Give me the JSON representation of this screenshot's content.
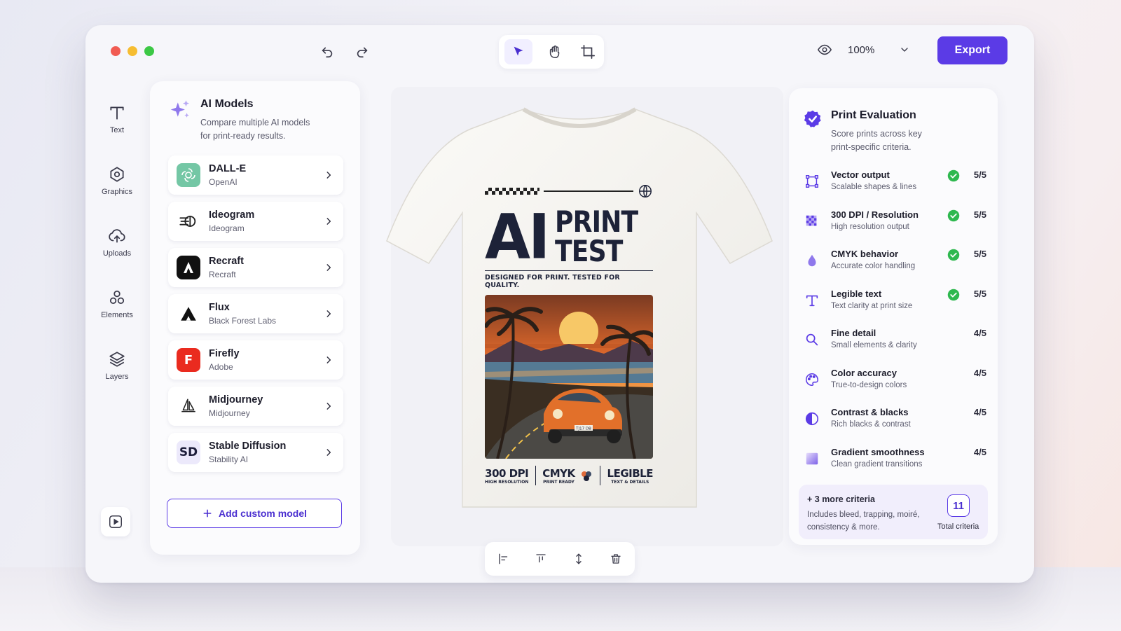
{
  "toolbar": {
    "zoom": "100%",
    "export_label": "Export"
  },
  "rail": [
    {
      "label": "Text",
      "icon": "text-icon"
    },
    {
      "label": "Graphics",
      "icon": "graphics-icon"
    },
    {
      "label": "Uploads",
      "icon": "upload-icon"
    },
    {
      "label": "Elements",
      "icon": "elements-icon"
    },
    {
      "label": "Layers",
      "icon": "layers-icon"
    }
  ],
  "models_panel": {
    "title": "AI Models",
    "subtitle": "Compare multiple AI models for print-ready results.",
    "models": [
      {
        "name": "DALL-E",
        "vendor": "OpenAI",
        "logo": "openai-logo-icon",
        "color": "#74c7a5"
      },
      {
        "name": "Ideogram",
        "vendor": "Ideogram",
        "logo": "ideogram-logo-icon",
        "color": "#ffffff"
      },
      {
        "name": "Recraft",
        "vendor": "Recraft",
        "logo": "recraft-logo-icon",
        "color": "#111111"
      },
      {
        "name": "Flux",
        "vendor": "Black Forest Labs",
        "logo": "flux-logo-icon",
        "color": "#ffffff"
      },
      {
        "name": "Firefly",
        "vendor": "Adobe",
        "logo": "firefly-logo-icon",
        "color": "#ea2b1f",
        "mark": "F"
      },
      {
        "name": "Midjourney",
        "vendor": "Midjourney",
        "logo": "midjourney-logo-icon",
        "color": "#ffffff"
      },
      {
        "name": "Stable Diffusion",
        "vendor": "Stability AI",
        "logo": "stable-diffusion-logo-icon",
        "color": "#ece9fb",
        "mark": "SD"
      }
    ],
    "add_label": "Add custom model"
  },
  "design": {
    "headline_big": "AI",
    "headline_line1": "PRINT",
    "headline_line2": "TEST",
    "tagline": "DESIGNED FOR PRINT. TESTED FOR QUALITY.",
    "plate": "TJ17 DB",
    "stats": [
      {
        "big": "300 DPI",
        "small": "HIGH RESOLUTION"
      },
      {
        "big": "CMYK",
        "small": "PRINT READY"
      },
      {
        "big": "LEGIBLE",
        "small": "TEXT & DETAILS"
      }
    ]
  },
  "evaluation": {
    "title": "Print Evaluation",
    "subtitle": "Score prints across key print-specific criteria.",
    "criteria": [
      {
        "name": "Vector output",
        "desc": "Scalable shapes & lines",
        "score": "5/5",
        "passed": true,
        "icon": "vector-icon"
      },
      {
        "name": "300 DPI / Resolution",
        "desc": "High resolution output",
        "score": "5/5",
        "passed": true,
        "icon": "resolution-icon"
      },
      {
        "name": "CMYK behavior",
        "desc": "Accurate color handling",
        "score": "5/5",
        "passed": true,
        "icon": "droplet-icon"
      },
      {
        "name": "Legible text",
        "desc": "Text clarity at print size",
        "score": "5/5",
        "passed": true,
        "icon": "text-icon"
      },
      {
        "name": "Fine detail",
        "desc": "Small elements & clarity",
        "score": "4/5",
        "passed": false,
        "icon": "magnifier-icon"
      },
      {
        "name": "Color accuracy",
        "desc": "True-to-design colors",
        "score": "4/5",
        "passed": false,
        "icon": "palette-icon"
      },
      {
        "name": "Contrast & blacks",
        "desc": "Rich blacks & contrast",
        "score": "4/5",
        "passed": false,
        "icon": "contrast-icon"
      },
      {
        "name": "Gradient smoothness",
        "desc": "Clean gradient transitions",
        "score": "4/5",
        "passed": false,
        "icon": "gradient-icon"
      }
    ],
    "more_title": "+ 3 more criteria",
    "more_desc": "Includes bleed, trapping, moiré, consistency & more.",
    "total_count": "11",
    "total_label": "Total criteria"
  },
  "colors": {
    "accent": "#5b3be6",
    "check": "#2fb84f"
  }
}
